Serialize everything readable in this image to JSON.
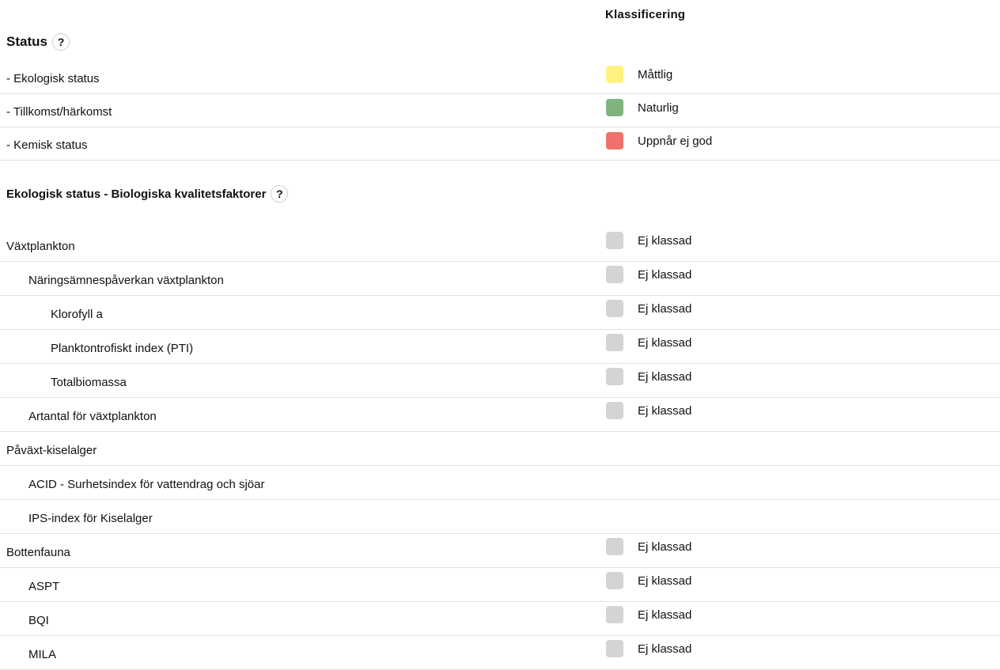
{
  "header": {
    "classification_label": "Klassificering"
  },
  "status_section": {
    "title": "Status",
    "help": "?",
    "rows": [
      {
        "label": "- Ekologisk status",
        "value": "Måttlig",
        "color": "#fff27f"
      },
      {
        "label": "- Tillkomst/härkomst",
        "value": "Naturlig",
        "color": "#7fb47f"
      },
      {
        "label": "- Kemisk status",
        "value": "Uppnår ej god",
        "color": "#f0716b"
      }
    ]
  },
  "eko_section": {
    "title": "Ekologisk status - Biologiska kvalitetsfaktorer",
    "help": "?",
    "rows": [
      {
        "label": "Växtplankton",
        "level": 0,
        "value": "Ej klassad",
        "color": "#d4d4d4"
      },
      {
        "label": "Näringsämnespåverkan växtplankton",
        "level": 1,
        "value": "Ej klassad",
        "color": "#d4d4d4"
      },
      {
        "label": "Klorofyll a",
        "level": 2,
        "value": "Ej klassad",
        "color": "#d4d4d4"
      },
      {
        "label": "Planktontrofiskt index (PTI)",
        "level": 2,
        "value": "Ej klassad",
        "color": "#d4d4d4"
      },
      {
        "label": "Totalbiomassa",
        "level": 2,
        "value": "Ej klassad",
        "color": "#d4d4d4"
      },
      {
        "label": "Artantal för växtplankton",
        "level": 1,
        "value": "Ej klassad",
        "color": "#d4d4d4"
      },
      {
        "label": "Påväxt-kiselalger",
        "level": 0,
        "value": "",
        "color": ""
      },
      {
        "label": "ACID - Surhetsindex för vattendrag och sjöar",
        "level": 1,
        "value": "",
        "color": ""
      },
      {
        "label": "IPS-index för Kiselalger",
        "level": 1,
        "value": "",
        "color": ""
      },
      {
        "label": "Bottenfauna",
        "level": 0,
        "value": "Ej klassad",
        "color": "#d4d4d4"
      },
      {
        "label": "ASPT",
        "level": 1,
        "value": "Ej klassad",
        "color": "#d4d4d4"
      },
      {
        "label": "BQI",
        "level": 1,
        "value": "Ej klassad",
        "color": "#d4d4d4"
      },
      {
        "label": "MILA",
        "level": 1,
        "value": "Ej klassad",
        "color": "#d4d4d4"
      }
    ]
  }
}
